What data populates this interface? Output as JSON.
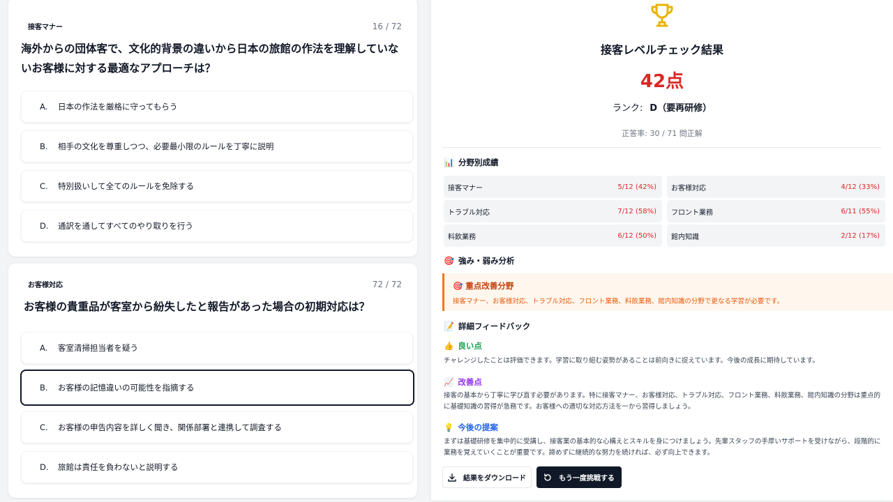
{
  "q1": {
    "category": "接客マナー",
    "count": "16 / 72",
    "question": "海外からの団体客で、文化的背景の違いから日本の旅館の作法を理解していないお客様に対する最適なアプローチは？",
    "options": [
      {
        "letter": "A.",
        "text": "日本の作法を厳格に守ってもらう"
      },
      {
        "letter": "B.",
        "text": "相手の文化を尊重しつつ、必要最小限のルールを丁寧に説明"
      },
      {
        "letter": "C.",
        "text": "特別扱いして全てのルールを免除する"
      },
      {
        "letter": "D.",
        "text": "通訳を通してすべてのやり取りを行う"
      }
    ]
  },
  "q2": {
    "category": "お客様対応",
    "count": "72 / 72",
    "question": "お客様の貴重品が客室から紛失したと報告があった場合の初期対応は？",
    "selected": "B.",
    "options": [
      {
        "letter": "A.",
        "text": "客室清掃担当者を疑う"
      },
      {
        "letter": "B.",
        "text": "お客様の記憶違いの可能性を指摘する"
      },
      {
        "letter": "C.",
        "text": "お客様の申告内容を詳しく聞き、関係部署と連携して調査する"
      },
      {
        "letter": "D.",
        "text": "旅館は責任を負わないと説明する"
      }
    ]
  },
  "result": {
    "icon": "trophy-icon",
    "title": "接客レベルチェック結果",
    "score": "42点",
    "rank_label": "ランク:",
    "rank_value": "D（要再研修）",
    "accuracy": "正答率: 30 / 71 問正解",
    "category_section": {
      "icon": "📊",
      "title": "分野別成績"
    },
    "stats": [
      {
        "name": "接客マナー",
        "value": "5/12 (42%)"
      },
      {
        "name": "お客様対応",
        "value": "4/12 (33%)"
      },
      {
        "name": "トラブル対応",
        "value": "7/12 (58%)"
      },
      {
        "name": "フロント業務",
        "value": "6/11 (55%)"
      },
      {
        "name": "料飲業務",
        "value": "6/12 (50%)"
      },
      {
        "name": "館内知識",
        "value": "2/12 (17%)"
      }
    ],
    "analysis_section": {
      "icon": "🎯",
      "title": "強み・弱み分析"
    },
    "focus": {
      "icon": "🎯",
      "title": "重点改善分野",
      "body": "接客マナー、お客様対応、トラブル対応、フロント業務、料飲業務、館内知識の分野で更なる学習が必要です。"
    },
    "feedback_section": {
      "icon": "📝",
      "title": "詳細フィードバック"
    },
    "good": {
      "icon": "👍",
      "title": "良い点",
      "body": "チャレンジしたことは評価できます。学習に取り組む姿勢があることは前向きに捉えています。今後の成長に期待しています。"
    },
    "improve": {
      "icon": "📈",
      "title": "改善点",
      "body": "接客の基本から丁寧に学び直す必要があります。特に接客マナー、お客様対応、トラブル対応、フロント業務、料飲業務、館内知識の分野は重点的に基礎知識の習得が急務です。お客様への適切な対応方法を一から習得しましょう。"
    },
    "suggest": {
      "icon": "💡",
      "title": "今後の提案",
      "body": "まずは基礎研修を集中的に受講し、接客業の基本的な心構えとスキルを身につけましょう。先輩スタッフの手厚いサポートを受けながら、段階的に業務を覚えていくことが重要です。諦めずに継続的な努力を続ければ、必ず向上できます。"
    },
    "download_label": "結果をダウンロード",
    "retry_label": "もう一度挑戦する"
  },
  "colors": {
    "score": "#dc2626",
    "trophy": "#eab308",
    "focus_border": "#f97316",
    "good": "#16a34a",
    "improve": "#9333ea",
    "suggest": "#2563eb"
  }
}
